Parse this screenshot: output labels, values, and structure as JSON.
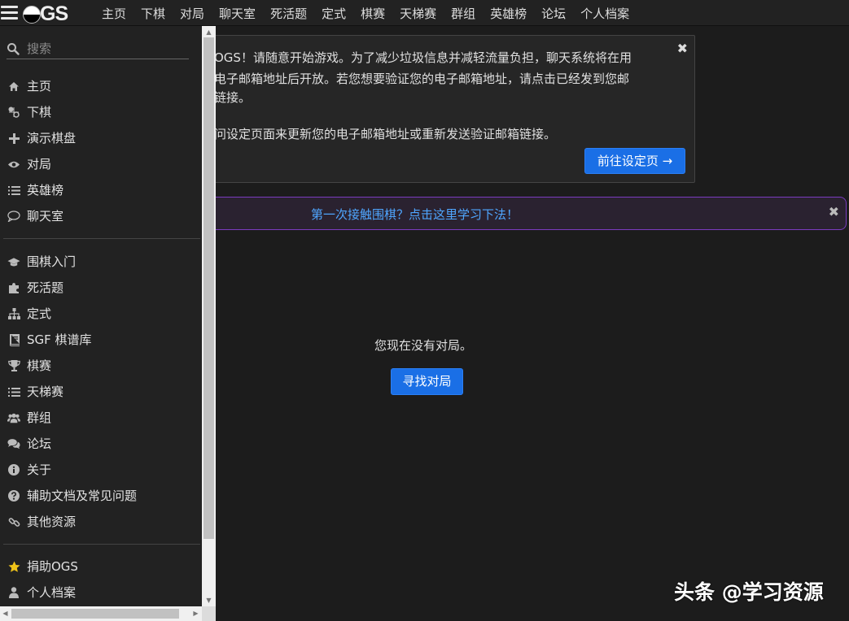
{
  "app": {
    "logo_text": "GS"
  },
  "nav": {
    "links": [
      "主页",
      "下棋",
      "对局",
      "聊天室",
      "死活题",
      "定式",
      "棋赛",
      "天梯赛",
      "群组",
      "英雄榜",
      "论坛",
      "个人档案"
    ]
  },
  "announcement": {
    "lines": [
      "到OGS！请随意开始游戏。为了减少垃圾信息并减轻流量负担，聊天系统将在用",
      "证电子邮箱地址后开放。若您想要验证您的电子邮箱地址，请点击已经发到您邮",
      "活链接。",
      "",
      "访问设定页面来更新您的电子邮箱地址或重新发送验证邮箱链接。"
    ],
    "close": "✖",
    "settings_button": "前往设定页 →"
  },
  "learn_bar": {
    "text": "第一次接触围棋？点击这里学习下法！",
    "close": "✖"
  },
  "main": {
    "no_games_text": "您现在没有对局。",
    "find_game_button": "寻找对局"
  },
  "watermark": "头条 @学习资源",
  "sidebar": {
    "search_placeholder": "搜索",
    "group1": [
      {
        "label": "主页",
        "icon": "home-icon"
      },
      {
        "label": "下棋",
        "icon": "play-stones-icon"
      },
      {
        "label": "演示棋盘",
        "icon": "plus-icon"
      },
      {
        "label": "对局",
        "icon": "eye-icon"
      },
      {
        "label": "英雄榜",
        "icon": "list-icon"
      },
      {
        "label": "聊天室",
        "icon": "chat-bubble-icon"
      }
    ],
    "group2": [
      {
        "label": "围棋入门",
        "icon": "graduation-cap-icon"
      },
      {
        "label": "死活题",
        "icon": "puzzle-icon"
      },
      {
        "label": "定式",
        "icon": "sitemap-icon"
      },
      {
        "label": "SGF 棋谱库",
        "icon": "book-icon"
      },
      {
        "label": "棋赛",
        "icon": "trophy-icon"
      },
      {
        "label": "天梯赛",
        "icon": "list-icon"
      },
      {
        "label": "群组",
        "icon": "users-icon"
      },
      {
        "label": "论坛",
        "icon": "comments-icon"
      },
      {
        "label": "关于",
        "icon": "info-icon"
      },
      {
        "label": "辅助文档及常见问题",
        "icon": "question-icon"
      },
      {
        "label": "其他资源",
        "icon": "link-icon"
      }
    ],
    "group3": [
      {
        "label": "捐助OGS",
        "icon": "star-icon"
      },
      {
        "label": "个人档案",
        "icon": "user-icon"
      }
    ]
  },
  "colors": {
    "accent_blue": "#1a6fe6",
    "link_blue": "#4fa6ff",
    "purple_border": "#7b3cc0",
    "star_gold": "#f0c419"
  }
}
